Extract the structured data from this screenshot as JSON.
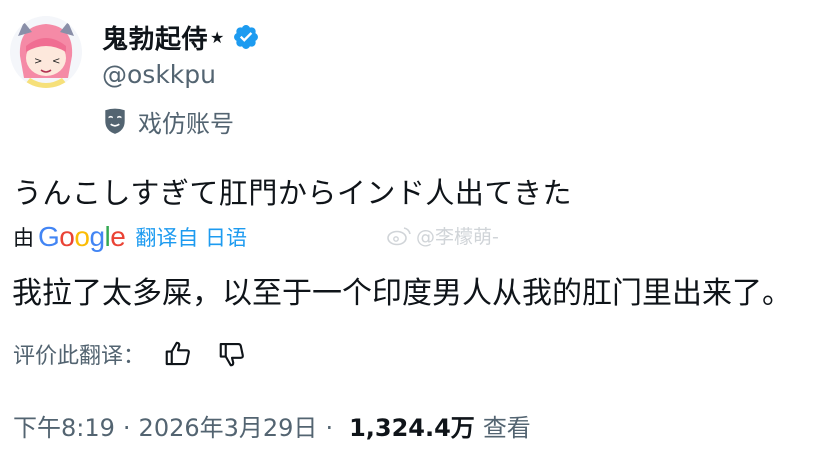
{
  "author": {
    "display_name": "鬼勃起侍",
    "star_glyph": "★",
    "handle": "@oskkpu",
    "parody_label": "戏仿账号",
    "verified_color": "#1d9bf0"
  },
  "tweet": {
    "original_text": "うんこしすぎて肛門からインド人出てきた",
    "translation_by": "由",
    "google_logo": [
      "G",
      "o",
      "o",
      "g",
      "l",
      "e"
    ],
    "translated_from": "翻译自 日语",
    "translated_text": "我拉了太多屎，以至于一个印度男人从我的肛门里出来了。"
  },
  "watermark": {
    "text": "@李檬萌-"
  },
  "rating": {
    "label": "评价此翻译：",
    "thumbs_up_icon": "thumbs-up-icon",
    "thumbs_down_icon": "thumbs-down-icon"
  },
  "meta": {
    "time": "下午8:19",
    "separator": "·",
    "date": "2026年3月29日",
    "views_count": "1,324.4万",
    "views_label": "查看"
  }
}
